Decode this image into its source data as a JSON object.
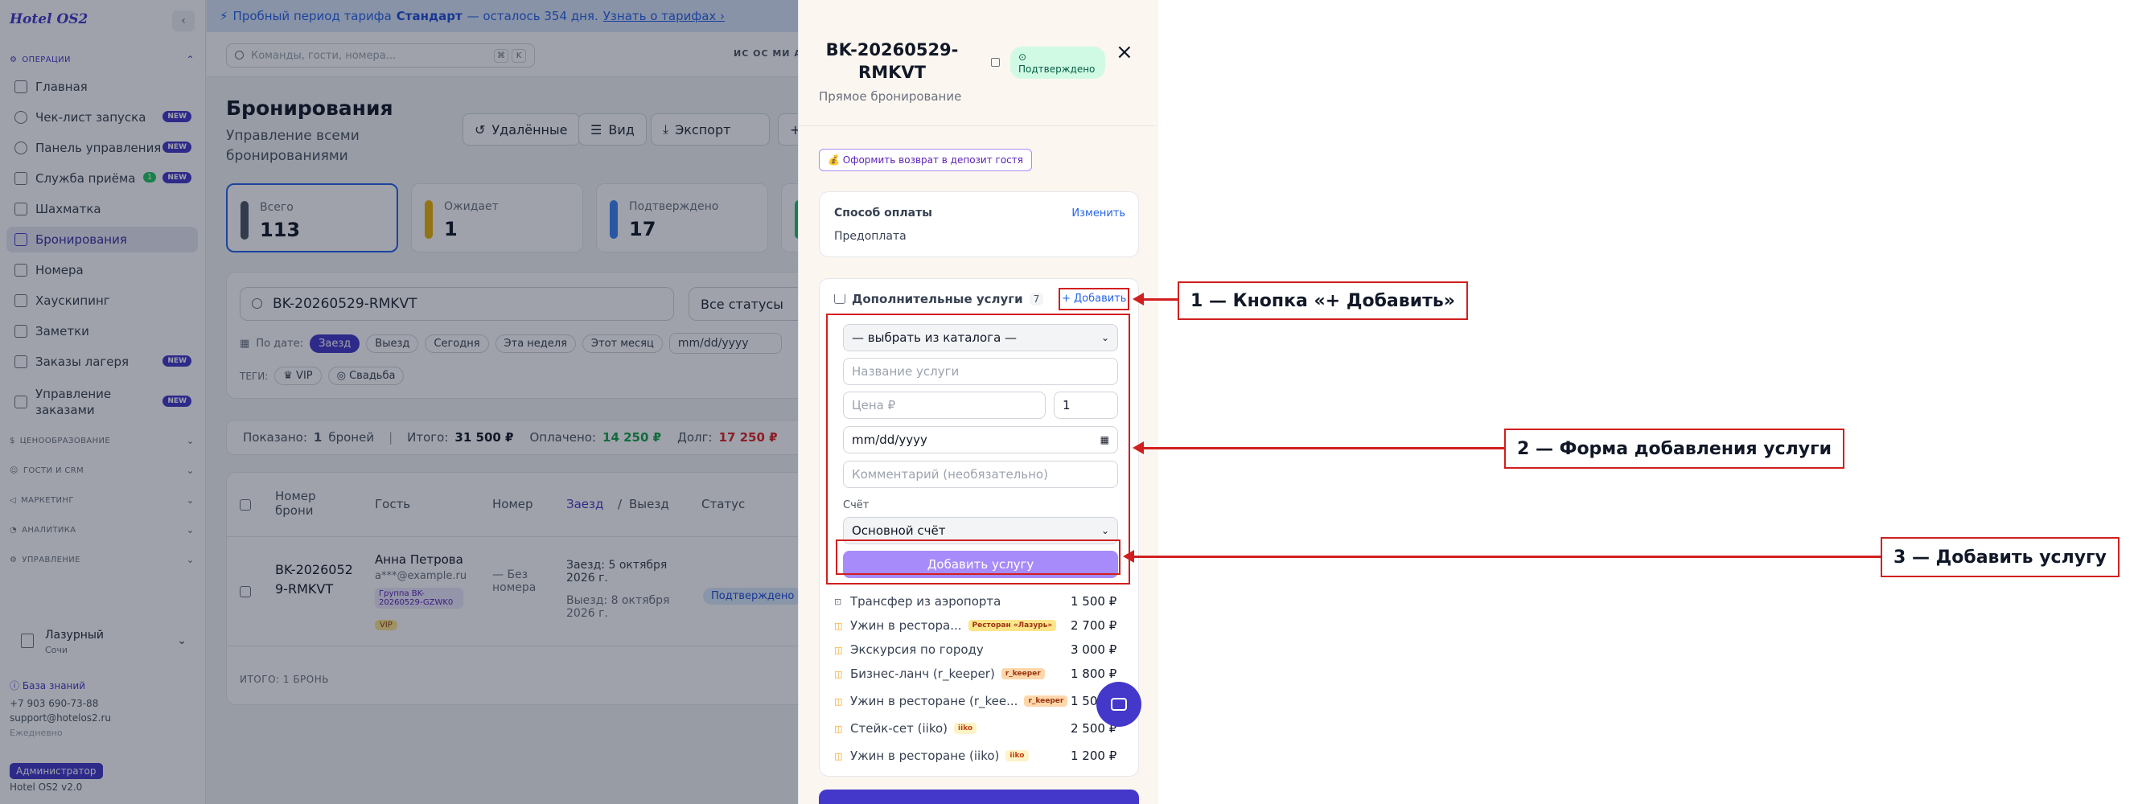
{
  "sidebar": {
    "logo": "Hotel OS2",
    "collapse": "‹",
    "sections": {
      "operations": "ОПЕРАЦИИ",
      "pricing": "ЦЕНООБРАЗОВАНИЕ",
      "guests": "ГОСТИ И CRM",
      "marketing": "МАРКЕТИНГ",
      "analytics": "АНАЛИТИКА",
      "management": "УПРАВЛЕНИЕ"
    },
    "items": [
      {
        "label": "Главная"
      },
      {
        "label": "Чек-лист запуска",
        "badge": "NEW"
      },
      {
        "label": "Панель управления",
        "badge": "NEW"
      },
      {
        "label": "Служба приёма",
        "badge": "NEW",
        "count": "1"
      },
      {
        "label": "Шахматка"
      },
      {
        "label": "Бронирования"
      },
      {
        "label": "Номера"
      },
      {
        "label": "Хаускипинг"
      },
      {
        "label": "Заметки"
      },
      {
        "label": "Заказы лагеря",
        "badge": "NEW"
      },
      {
        "label": "Управление заказами",
        "badge": "NEW"
      }
    ],
    "hotel": {
      "name": "Лазурный",
      "city": "Сочи"
    },
    "kb": "База знаний",
    "phone": "+7 903 690-73-88",
    "email": "support@hotelos2.ru",
    "daily": "Ежедневно",
    "role": "Администратор",
    "version": "Hotel OS2 v2.0"
  },
  "trial": {
    "prefix": "Пробный период тарифа",
    "plan": "Стандарт",
    "rest": "— осталось 354 дня.",
    "link": "Узнать о тарифах ›",
    "close": "×"
  },
  "topbar": {
    "search_placeholder": "Команды, гости, номера...",
    "kbd1": "⌘",
    "kbd2": "K",
    "avatars": "ИС ОС МИ АК"
  },
  "page": {
    "title": "Бронирования",
    "subtitle": "Управление всеми бронированиями"
  },
  "toolbar": {
    "deleted": "Удалённые",
    "view": "Вид",
    "export": "Экспорт"
  },
  "stats": [
    {
      "label": "Всего",
      "value": "113",
      "color": "#4b5563"
    },
    {
      "label": "Ожидает",
      "value": "1",
      "color": "#eab308"
    },
    {
      "label": "Подтверждено",
      "value": "17",
      "color": "#3b82f6"
    }
  ],
  "filters": {
    "search_value": "BK-20260529-RMKVT",
    "status": "Все статусы",
    "by_date": "По дате:",
    "chips": [
      "Заезд",
      "Выезд",
      "Сегодня",
      "Эта неделя",
      "Этот месяц"
    ],
    "date_placeholder": "mm/dd/yyyy",
    "tags_label": "ТЕГИ:",
    "tags": [
      "VIP",
      "Свадьба"
    ]
  },
  "summary": {
    "shown_label": "Показано:",
    "shown_value": "1",
    "shown_unit": "броней",
    "total_label": "Итого:",
    "total_value": "31 500 ₽",
    "paid_label": "Оплачено:",
    "paid_value": "14 250 ₽",
    "debt_label": "Долг:",
    "debt_value": "17 250 ₽"
  },
  "table": {
    "headers": {
      "number": "Номер брони",
      "guest": "Гость",
      "room": "Номер",
      "checkin": "Заезд",
      "checkout": "Выезд",
      "status": "Статус"
    },
    "row": {
      "number": "BK-20260529-RMKVT",
      "guest_name": "Анна Петрова",
      "guest_email": "a***@example.ru",
      "group": "Группа BK-20260529-GZWK0",
      "vip": "VIP",
      "room": "— Без номера",
      "checkin": "Заезд: 5 октября 2026 г.",
      "checkout": "Выезд: 8 октября 2026 г.",
      "status": "Подтверждено"
    },
    "footer": "ИТОГО: 1 БРОНЬ"
  },
  "drawer": {
    "title": "BK-20260529-RMKVT",
    "status": "Подтверждено",
    "subtitle": "Прямое бронирование",
    "close": "×",
    "refund": "💰 Оформить возврат в депозит гостя",
    "payment": {
      "title": "Способ оплаты",
      "edit": "Изменить",
      "value": "Предоплата"
    },
    "services": {
      "title": "Дополнительные услуги",
      "count": "7",
      "add": "+ Добавить",
      "form": {
        "catalog": "— выбрать из каталога —",
        "name_ph": "Название услуги",
        "price_ph": "Цена ₽",
        "qty": "1",
        "date_ph": "mm/dd/yyyy",
        "comment_ph": "Комментарий (необязательно)",
        "account_label": "Счёт",
        "account": "Основной счёт",
        "submit": "Добавить услугу"
      },
      "items": [
        {
          "name": "Трансфер из аэропорта",
          "price": "1 500 ₽",
          "tag": ""
        },
        {
          "name": "Ужин в рестора...",
          "price": "2 700 ₽",
          "tag": "Ресторан «Лазурь»"
        },
        {
          "name": "Экскурсия по городу",
          "price": "3 000 ₽",
          "tag": ""
        },
        {
          "name": "Бизнес-ланч (r_keeper)",
          "price": "1 800 ₽",
          "tag": "r_keeper"
        },
        {
          "name": "Ужин в ресторане (r_kee...",
          "price": "1 500 ₽",
          "tag": "r_keeper"
        },
        {
          "name": "Стейк-сет (iiko)",
          "price": "2 500 ₽",
          "tag": "iiko"
        },
        {
          "name": "Ужин в ресторане (iiko)",
          "price": "1 200 ₽",
          "tag": "iiko"
        }
      ]
    }
  },
  "callouts": {
    "c1": "1 — Кнопка «+ Добавить»",
    "c2": "2 — Форма добавления услуги",
    "c3": "3 — Добавить услугу"
  }
}
